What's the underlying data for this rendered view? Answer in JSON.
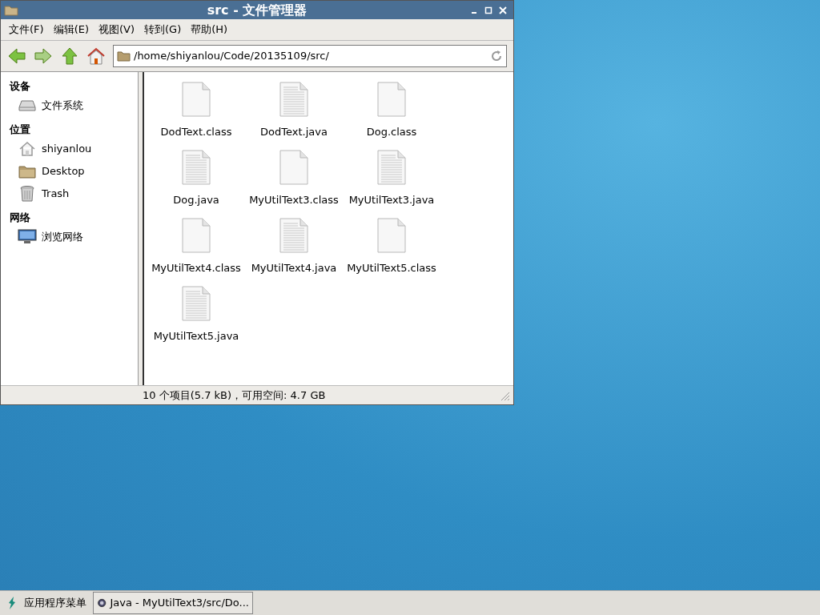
{
  "window": {
    "title": "src - 文件管理器"
  },
  "menu": [
    "文件(F)",
    "编辑(E)",
    "视图(V)",
    "转到(G)",
    "帮助(H)"
  ],
  "toolbar": {
    "location": "/home/shiyanlou/Code/20135109/src/"
  },
  "sidebar": [
    {
      "heading": "设备",
      "items": [
        {
          "label": "文件系统",
          "kind": "drive"
        }
      ]
    },
    {
      "heading": "位置",
      "items": [
        {
          "label": "shiyanlou",
          "kind": "home"
        },
        {
          "label": "Desktop",
          "kind": "folder"
        },
        {
          "label": "Trash",
          "kind": "trash"
        }
      ]
    },
    {
      "heading": "网络",
      "items": [
        {
          "label": "浏览网络",
          "kind": "network"
        }
      ]
    }
  ],
  "files": [
    {
      "name": "DodText.class",
      "kind": "binary"
    },
    {
      "name": "DodText.java",
      "kind": "text"
    },
    {
      "name": "Dog.class",
      "kind": "binary"
    },
    {
      "name": "Dog.java",
      "kind": "text"
    },
    {
      "name": "MyUtilText3.class",
      "kind": "binary"
    },
    {
      "name": "MyUtilText3.java",
      "kind": "text"
    },
    {
      "name": "MyUtilText4.class",
      "kind": "binary"
    },
    {
      "name": "MyUtilText4.java",
      "kind": "text"
    },
    {
      "name": "MyUtilText5.class",
      "kind": "binary"
    },
    {
      "name": "MyUtilText5.java",
      "kind": "text"
    }
  ],
  "status_bar": "10 个项目(5.7 kB)，可用空间: 4.7 GB",
  "taskbar": {
    "menu_label": "应用程序菜单",
    "tasks": [
      {
        "label": "Java - MyUtilText3/src/Do..."
      }
    ]
  }
}
